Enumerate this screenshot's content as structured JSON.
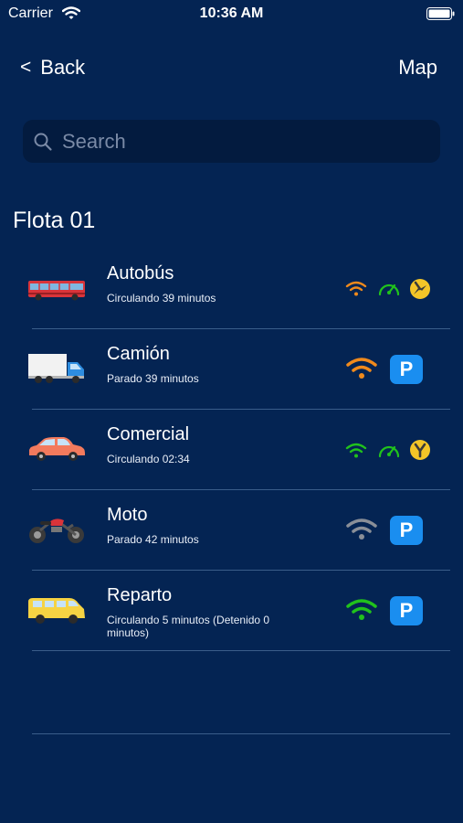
{
  "status_bar": {
    "carrier": "Carrier",
    "time": "10:36 AM"
  },
  "nav": {
    "back_label": "Back",
    "back_chevron": "<",
    "map_label": "Map"
  },
  "search": {
    "placeholder": "Search",
    "value": ""
  },
  "section_title": "Flota 01",
  "colors": {
    "background": "#042453",
    "search_bg": "#031b3f",
    "separator": "#3a5d8a",
    "orange": "#f08a1c",
    "green": "#21c21c",
    "grey": "#8a8f98",
    "yellow": "#f3c528",
    "parking_blue": "#1a8ef0"
  },
  "vehicles": [
    {
      "name": "Autobús",
      "status": "Circulando 39 minutos",
      "vehicle_icon": "bus-icon",
      "signal_color": "orange",
      "indicators": [
        "wifi-icon",
        "speedometer-icon",
        "direction-compass-icon"
      ]
    },
    {
      "name": "Camión",
      "status": "Parado 39 minutos",
      "vehicle_icon": "truck-icon",
      "signal_color": "orange",
      "indicators": [
        "wifi-icon",
        "parking-icon"
      ],
      "parking_label": "P"
    },
    {
      "name": "Comercial",
      "status": "Circulando 02:34",
      "vehicle_icon": "car-icon",
      "signal_color": "green",
      "indicators": [
        "wifi-icon",
        "speedometer-icon",
        "direction-compass-icon"
      ]
    },
    {
      "name": "Moto",
      "status": "Parado 42 minutos",
      "vehicle_icon": "motorcycle-icon",
      "signal_color": "grey",
      "indicators": [
        "wifi-icon",
        "parking-icon"
      ],
      "parking_label": "P"
    },
    {
      "name": "Reparto",
      "status": "Circulando 5 minutos (Detenido 0 minutos)",
      "vehicle_icon": "van-icon",
      "signal_color": "green",
      "indicators": [
        "wifi-icon",
        "parking-icon"
      ],
      "parking_label": "P"
    }
  ]
}
